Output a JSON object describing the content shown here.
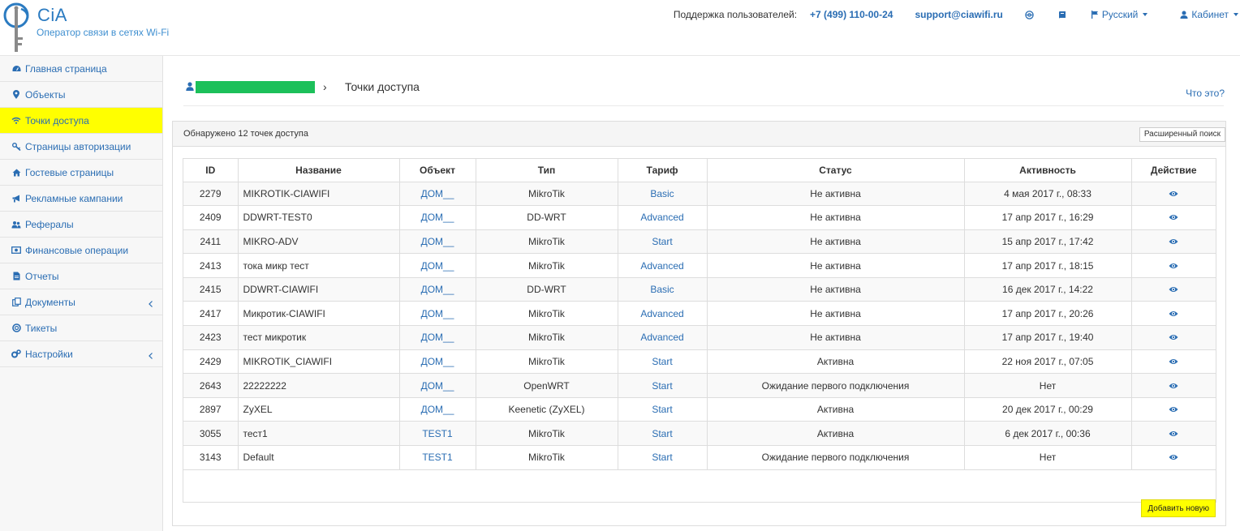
{
  "brand": {
    "name": "CiA",
    "tagline": "Оператор связи в сетях Wi-Fi",
    "color": "#2b7bc1"
  },
  "topbar": {
    "support_label": "Поддержка пользователей:",
    "phone": "+7 (499) 110-00-24",
    "email": "support@ciawifi.ru",
    "globe_icon": "globe-icon",
    "book_icon": "book-icon",
    "language": "Русский",
    "cabinet": "Кабинет"
  },
  "sidebar": {
    "items": [
      {
        "label": "Главная страница",
        "icon": "dashboard-icon"
      },
      {
        "label": "Объекты",
        "icon": "map-marker-icon"
      },
      {
        "label": "Точки доступа",
        "icon": "wifi-icon",
        "active": true
      },
      {
        "label": "Страницы авторизации",
        "icon": "key-icon"
      },
      {
        "label": "Гостевые страницы",
        "icon": "home-icon"
      },
      {
        "label": "Рекламные кампании",
        "icon": "bullhorn-icon"
      },
      {
        "label": "Рефералы",
        "icon": "users-icon"
      },
      {
        "label": "Финансовые операции",
        "icon": "money-icon"
      },
      {
        "label": "Отчеты",
        "icon": "file-icon"
      },
      {
        "label": "Документы",
        "icon": "documents-icon",
        "has_submenu": true
      },
      {
        "label": "Тикеты",
        "icon": "lifebuoy-icon"
      },
      {
        "label": "Настройки",
        "icon": "cogs-icon",
        "has_submenu": true
      }
    ],
    "active_color": "#ffff00"
  },
  "breadcrumb": {
    "separator": "›",
    "current": "Точки доступа"
  },
  "help_link": "Что это?",
  "panel": {
    "title": "Обнаружено 12 точек доступа",
    "advanced_search": "Расширенный поиск",
    "add_new": "Добавить новую"
  },
  "table": {
    "headers": [
      "ID",
      "Название",
      "Объект",
      "Тип",
      "Тариф",
      "Статус",
      "Активность",
      "Действие"
    ],
    "rows": [
      {
        "id": "2279",
        "name": "MIKROTIK-CIAWIFI",
        "object": "ДОМ__",
        "type": "MikroTik",
        "tariff": "Basic",
        "status": "Не активна",
        "activity": "4 мая 2017 г., 08:33"
      },
      {
        "id": "2409",
        "name": "DDWRT-TEST0",
        "object": "ДОМ__",
        "type": "DD-WRT",
        "tariff": "Advanced",
        "status": "Не активна",
        "activity": "17 апр 2017 г., 16:29"
      },
      {
        "id": "2411",
        "name": "MIKRO-ADV",
        "object": "ДОМ__",
        "type": "MikroTik",
        "tariff": "Start",
        "status": "Не активна",
        "activity": "15 апр 2017 г., 17:42"
      },
      {
        "id": "2413",
        "name": "тока микр тест",
        "object": "ДОМ__",
        "type": "MikroTik",
        "tariff": "Advanced",
        "status": "Не активна",
        "activity": "17 апр 2017 г., 18:15"
      },
      {
        "id": "2415",
        "name": "DDWRT-CIAWIFI",
        "object": "ДОМ__",
        "type": "DD-WRT",
        "tariff": "Basic",
        "status": "Не активна",
        "activity": "16 дек 2017 г., 14:22"
      },
      {
        "id": "2417",
        "name": "Микротик-CIAWIFI",
        "object": "ДОМ__",
        "type": "MikroTik",
        "tariff": "Advanced",
        "status": "Не активна",
        "activity": "17 апр 2017 г., 20:26"
      },
      {
        "id": "2423",
        "name": "тест микротик",
        "object": "ДОМ__",
        "type": "MikroTik",
        "tariff": "Advanced",
        "status": "Не активна",
        "activity": "17 апр 2017 г., 19:40"
      },
      {
        "id": "2429",
        "name": "MIKROTIK_CIAWIFI",
        "object": "ДОМ__",
        "type": "MikroTik",
        "tariff": "Start",
        "status": "Активна",
        "activity": "22 ноя 2017 г., 07:05"
      },
      {
        "id": "2643",
        "name": "22222222",
        "object": "ДОМ__",
        "type": "OpenWRT",
        "tariff": "Start",
        "status": "Ожидание первого подключения",
        "activity": "Нет"
      },
      {
        "id": "2897",
        "name": "ZyXEL",
        "object": "ДОМ__",
        "type": "Keenetic (ZyXEL)",
        "tariff": "Start",
        "status": "Активна",
        "activity": "20 дек 2017 г., 00:29"
      },
      {
        "id": "3055",
        "name": "тест1",
        "object": "TEST1",
        "type": "MikroTik",
        "tariff": "Start",
        "status": "Активна",
        "activity": "6 дек 2017 г., 00:36"
      },
      {
        "id": "3143",
        "name": "Default",
        "object": "TEST1",
        "type": "MikroTik",
        "tariff": "Start",
        "status": "Ожидание первого подключения",
        "activity": "Нет"
      }
    ],
    "action_icon": "eye-icon"
  }
}
